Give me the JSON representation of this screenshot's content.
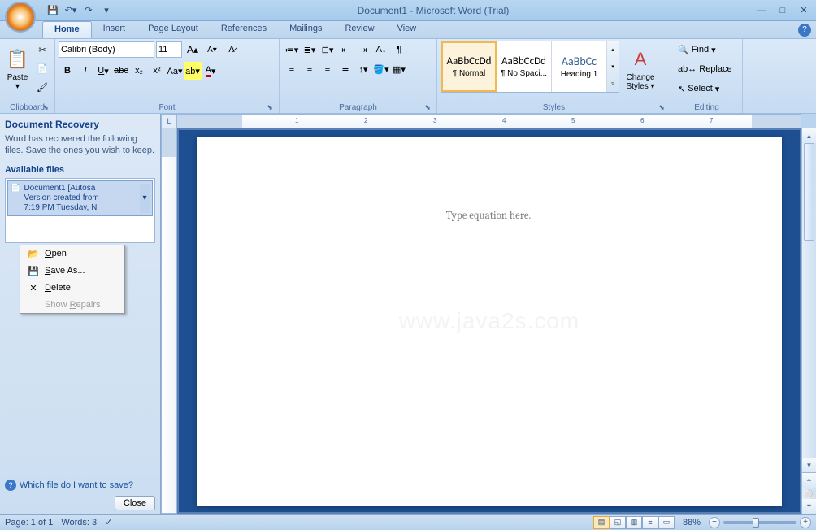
{
  "titlebar": {
    "title": "Document1 - Microsoft Word (Trial)"
  },
  "qat": {
    "save": "💾",
    "undo": "↶",
    "redo": "↷"
  },
  "tabs": [
    "Home",
    "Insert",
    "Page Layout",
    "References",
    "Mailings",
    "Review",
    "View"
  ],
  "ribbon": {
    "clipboard": {
      "label": "Clipboard",
      "paste": "Paste"
    },
    "font": {
      "label": "Font",
      "name": "Calibri (Body)",
      "size": "11"
    },
    "paragraph": {
      "label": "Paragraph"
    },
    "styles": {
      "label": "Styles",
      "items": [
        {
          "preview": "AaBbCcDd",
          "name": "¶ Normal",
          "selected": true
        },
        {
          "preview": "AaBbCcDd",
          "name": "¶ No Spaci...",
          "selected": false
        },
        {
          "preview": "AaBbCc",
          "name": "Heading 1",
          "selected": false,
          "heading": true
        }
      ],
      "change": "Change Styles"
    },
    "editing": {
      "label": "Editing",
      "find": "Find",
      "replace": "Replace",
      "select": "Select"
    }
  },
  "recovery": {
    "header": "Document Recovery",
    "msg": "Word has recovered the following files.  Save the ones you wish to keep.",
    "avail": "Available files",
    "file": {
      "line1": "Document1  [Autosa",
      "line2": "Version created from",
      "line3": "7:19 PM Tuesday, N"
    },
    "menu": {
      "open": "Open",
      "saveas": "Save As...",
      "delete": "Delete",
      "repairs": "Show Repairs"
    },
    "link": "Which file do I want to save?",
    "close": "Close"
  },
  "ruler": [
    "1",
    "2",
    "3",
    "4",
    "5",
    "6",
    "7"
  ],
  "document": {
    "placeholder": "Type equation here."
  },
  "watermark": "www.java2s.com",
  "statusbar": {
    "page": "Page: 1 of 1",
    "words": "Words: 3",
    "zoom": "88%"
  }
}
